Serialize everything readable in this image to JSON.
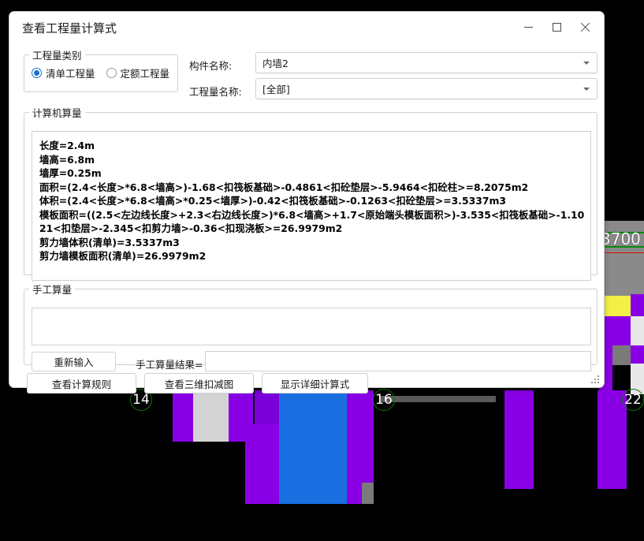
{
  "window": {
    "title": "查看工程量计算式",
    "controls": {
      "minimize": "minimize-icon",
      "maximize": "maximize-icon",
      "close": "close-icon"
    }
  },
  "quantity_type": {
    "legend": "工程量类别",
    "options": [
      {
        "label": "清单工程量",
        "checked": true
      },
      {
        "label": "定额工程量",
        "checked": false
      }
    ]
  },
  "fields": {
    "component_label": "构件名称:",
    "component_value": "内墙2",
    "quantity_name_label": "工程量名称:",
    "quantity_name_value": "[全部]"
  },
  "computer_calc": {
    "legend": "计算机算量",
    "lines": [
      "长度=2.4m",
      "墙高=6.8m",
      "墙厚=0.25m",
      "面积=(2.4<长度>*6.8<墙高>)-1.68<扣筏板基础>-0.4861<扣砼垫层>-5.9464<扣砼柱>=8.2075m2",
      "体积=(2.4<长度>*6.8<墙高>*0.25<墙厚>)-0.42<扣筏板基础>-0.1263<扣砼垫层>=3.5337m3",
      "模板面积=((2.5<左边线长度>+2.3<右边线长度>)*6.8<墙高>+1.7<原始端头模板面积>)-3.535<扣筏板基础>-1.1021<扣垫层>-2.345<扣剪力墙>-0.36<扣现浇板>=26.9979m2",
      "剪力墙体积(清单)=3.5337m3",
      "剪力墙模板面积(清单)=26.9979m2"
    ]
  },
  "manual_calc": {
    "legend": "手工算量",
    "input_value": "",
    "reinput_button": "重新输入",
    "result_label": "手工算量结果=",
    "result_value": ""
  },
  "bottom_buttons": [
    {
      "label": "查看计算规则"
    },
    {
      "label": "查看三维扣减图"
    },
    {
      "label": "显示详细计算式"
    }
  ],
  "background_scene": {
    "dimension_label": "3700",
    "axis_bubbles": [
      "14",
      "16",
      "22"
    ],
    "colors": {
      "canvas": "#000000",
      "wall_purple": "#8a00e6",
      "slab_blue": "#1a6fe0",
      "beam_yellow": "#f2ef45",
      "gray_panel": "#8a8a8a",
      "grid_green": "#0a8a0a",
      "grid_red": "#e01010"
    }
  }
}
